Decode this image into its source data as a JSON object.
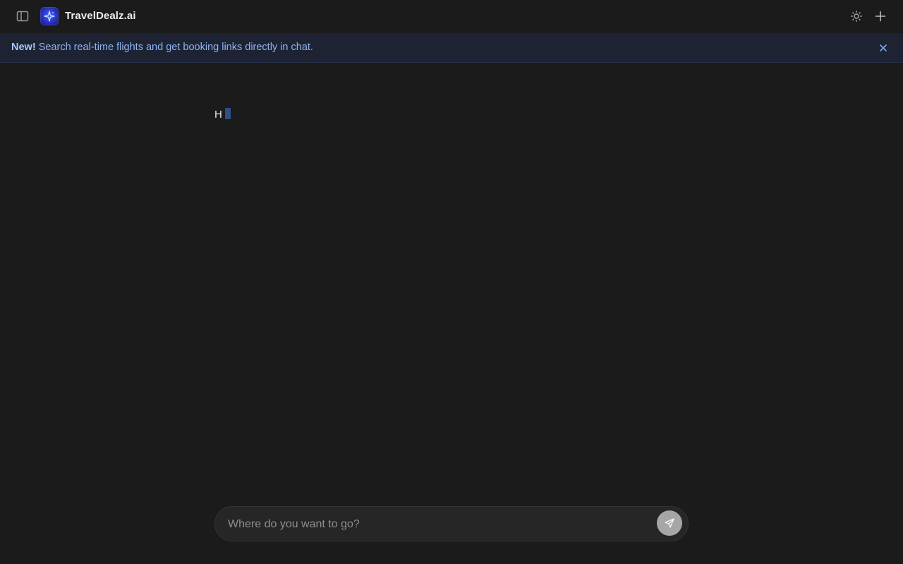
{
  "app": {
    "title": "TravelDealz.ai"
  },
  "header": {
    "icons": {
      "sidebar_toggle": "sidebar-icon",
      "logo": "sparkle-logo-icon",
      "theme": "sun-icon",
      "new_chat": "plus-icon"
    }
  },
  "banner": {
    "highlight": "New!",
    "message": "Search real-time flights and get booking links directly in chat.",
    "close_icon": "close-icon"
  },
  "chat": {
    "messages": [
      {
        "text": "H"
      }
    ]
  },
  "composer": {
    "placeholder": "Where do you want to go?",
    "value": "",
    "send_icon": "send-icon"
  },
  "colors": {
    "background": "#1b1b1b",
    "banner_bg": "#1d2333",
    "banner_text": "#8fb4f0",
    "accent": "#3e67ff",
    "send_button": "#a6a6a6"
  }
}
